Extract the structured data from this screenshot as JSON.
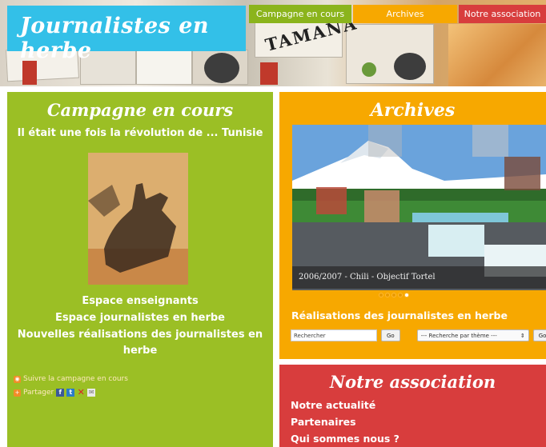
{
  "header": {
    "logo_text": "Journalistes en herbe",
    "collage_word": "TAMANA",
    "nav": [
      {
        "label": "Campagne en cours",
        "color": "#8bb41c"
      },
      {
        "label": "Archives",
        "color": "#f7a800"
      },
      {
        "label": "Notre association",
        "color": "#d83d3d"
      }
    ]
  },
  "campaign": {
    "title": "Campagne en cours",
    "subtitle": "Il était une fois la révolution de ... Tunisie",
    "links": [
      "Espace enseignants",
      "Espace journalistes en herbe",
      "Nouvelles réalisations des journalistes en herbe"
    ],
    "follow_label": "Suivre la campagne en cours",
    "share_label": "Partager",
    "color": "#9bbf25"
  },
  "archives": {
    "title": "Archives",
    "slide_caption": "2006/2007 - Chili - Objectif Tortel",
    "slide_count": 5,
    "active_slide": 5,
    "subtitle": "Réalisations des journalistes en herbe",
    "search_placeholder": "Rechercher",
    "search_button": "Go",
    "theme_select": "--- Recherche par thème ---",
    "theme_button": "Go",
    "color": "#f7a800"
  },
  "association": {
    "title": "Notre association",
    "links": [
      "Notre actualité",
      "Partenaires",
      "Qui sommes nous ?"
    ],
    "color": "#d83d3d"
  }
}
